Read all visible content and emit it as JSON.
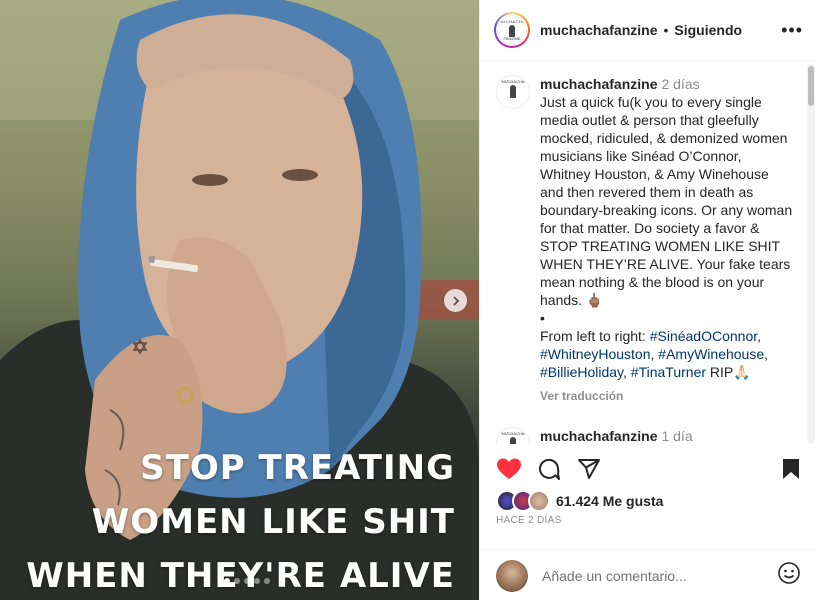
{
  "post": {
    "overlay_lines": [
      "STOP TREATING",
      "WOMEN LIKE SHIT",
      "WHEN THEY'RE ALIVE"
    ],
    "next_icon": "chevron-right-icon"
  },
  "header": {
    "username": "muchachafanzine",
    "separator": "•",
    "follow_status": "Siguiendo",
    "more_label": "•••",
    "logo_text_top": "MUCHACHA",
    "logo_text_bottom": "FANZINE"
  },
  "caption": {
    "username": "muchachafanzine",
    "time": "2 días",
    "text": "Just a quick fu(k you to every single media outlet & person that gleefully mocked, ridiculed, & demonized women musicians like Sinéad O’Connor, Whitney Houston, & Amy Winehouse and then revered them in death as boundary-breaking icons. Or any woman for that matter. Do society a favor & STOP TREATING WOMEN LIKE SHIT WHEN THEY’RE ALIVE. Your fake tears mean nothing & the blood is on your hands. 🖕🏽",
    "dots": "•⠀⠀⠀⠀⠀⠀⠀⠀",
    "from_left": "From left to right: ",
    "tag1": "#SinéadOConnor",
    "comma1": ",",
    "tag2": "#WhitneyHouston",
    "comma2": ", ",
    "tag3": "#AmyWinehouse",
    "comma3": ",",
    "tag4": "#BillieHoliday",
    "comma4": ", ",
    "tag5": "#TinaTurner",
    "rip": " RIP🙏🏻",
    "translate": "Ver traducción"
  },
  "comment2": {
    "username": "muchachafanzine",
    "time": "1 día"
  },
  "likes": {
    "count": "61.424 Me gusta",
    "ago": "HACE 2 DÍAS"
  },
  "add_comment": {
    "placeholder": "Añade un comentario..."
  },
  "colors": {
    "like_red": "#ff3040",
    "hashtag": "#00376b",
    "muted": "#8e8e8e"
  }
}
